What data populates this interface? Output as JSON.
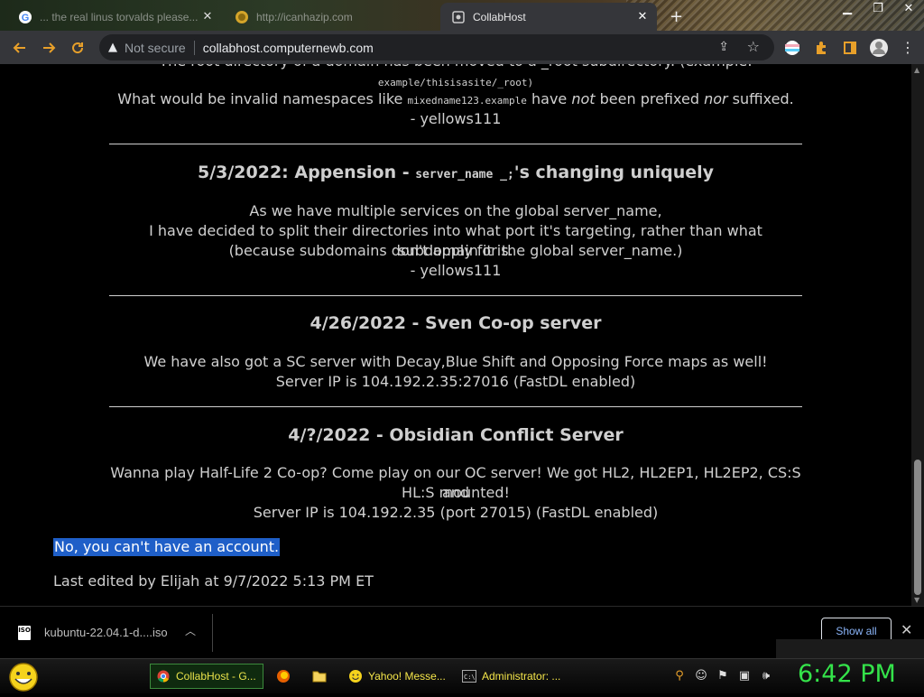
{
  "browser": {
    "tabs": [
      {
        "title": "... the real linus torvalds please...",
        "icon": "google-g-icon"
      },
      {
        "title": "http://icanhazip.com",
        "icon": "globe-icon"
      },
      {
        "title": "CollabHost",
        "icon": "collabhost-icon",
        "active": true
      }
    ],
    "address": {
      "security_label": "Not secure",
      "url": "collabhost.computernewb.com"
    },
    "window_controls": [
      "minimize",
      "maximize",
      "close"
    ]
  },
  "page": {
    "partial_top": "The root directory of a domain has been moved to a _root subdirectory. (example:",
    "partial_code": "example/thisisasite/_root)",
    "invalid_ns_pre": "What would be invalid namespaces like ",
    "invalid_ns_code": "mixedname123.example",
    "invalid_ns_mid1": " have ",
    "invalid_ns_em1": "not",
    "invalid_ns_mid2": " been prefixed ",
    "invalid_ns_em2": "nor",
    "invalid_ns_post": " suffixed.",
    "author1": "- yellows111",
    "posts": [
      {
        "title_pre": "5/3/2022: Appension - ",
        "title_code": "server_name _;",
        "title_post": "'s changing uniquely",
        "lines": [
          "As we have multiple services on the global server_name,",
          "I have decided to split their directories into what port it's targeting, rather than what subdomain it is.",
          "(because subdomains don't apply for the global server_name.)",
          "- yellows111"
        ]
      },
      {
        "title": "4/26/2022 - Sven Co-op server",
        "lines": [
          "We have also got a SC server with Decay,Blue Shift and Opposing Force maps as well!",
          "Server IP is 104.192.2.35:27016 (FastDL enabled)"
        ]
      },
      {
        "title": "4/?/2022 - Obsidian Conflict Server",
        "lines": [
          "Wanna play Half-Life 2 Co-op? Come play on our OC server! We got HL2, HL2EP1, HL2EP2, CS:S and",
          "HL:S mounted!",
          "Server IP is 104.192.2.35 (port 27015) (FastDL enabled)"
        ]
      }
    ],
    "account_note": "No, you can't have an account.",
    "last_edited": "Last edited by Elijah at 9/7/2022 5:13 PM ET"
  },
  "downloads": {
    "file_name": "kubuntu-22.04.1-d....iso",
    "file_badge": "ISO",
    "show_all_label": "Show all"
  },
  "taskbar": {
    "tasks": [
      {
        "label": "CollabHost - G...",
        "icon": "chrome-icon",
        "active": true
      },
      {
        "label": "",
        "icon": "firefox-icon"
      },
      {
        "label": "",
        "icon": "folder-icon"
      },
      {
        "label": "Yahoo! Messe...",
        "icon": "yahoo-messenger-icon"
      },
      {
        "label": "Administrator: ...",
        "icon": "cmd-icon"
      }
    ],
    "clock": "6:42 PM"
  },
  "colors": {
    "accent_orange": "#e8a02a",
    "selection_blue": "#1f5fc8",
    "clock_green": "#34e34a",
    "taskbar_text": "#f5e64a"
  }
}
